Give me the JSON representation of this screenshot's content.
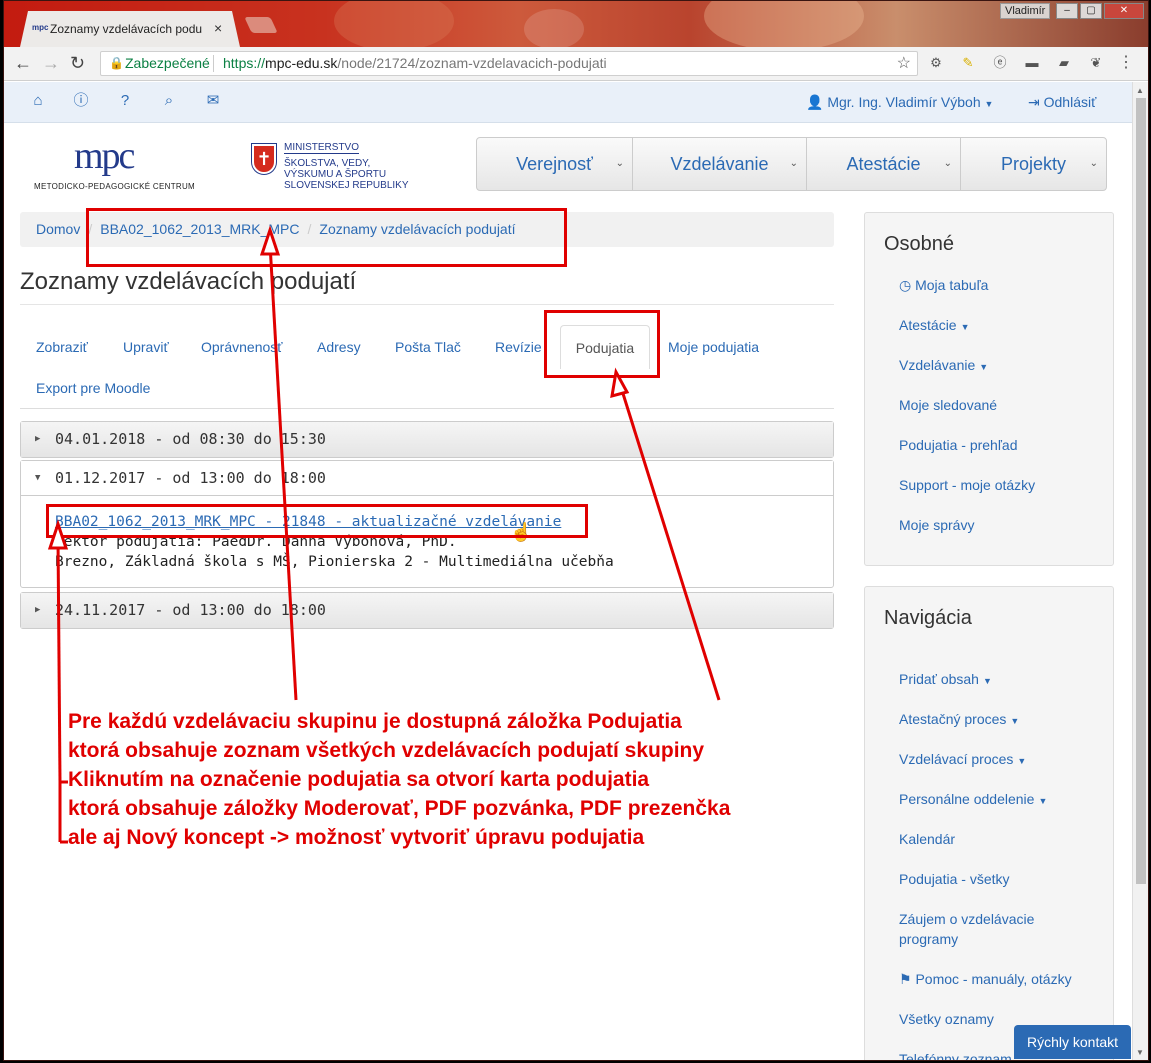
{
  "browser": {
    "tab_title": "Zoznamy vzdelávacích podu",
    "tab_close": "×",
    "favicon": "mpc",
    "user_label": "Vladimír",
    "window_buttons": [
      "–",
      "▢",
      "✕"
    ],
    "secure_label": "Zabezpečené",
    "url_scheme": "https://",
    "url_domain": "mpc-edu.sk",
    "url_path": "/node/21724/zoznam-vzdelavacich-podujati"
  },
  "topnav": {
    "user": "Mgr. Ing. Vladimír Výboh",
    "logout": "Odhlásiť"
  },
  "header": {
    "logo_text": "mpc",
    "logo_subtitle": "METODICKO-PEDAGOGICKÉ CENTRUM",
    "ministry_lines": [
      "MINISTERSTVO",
      "ŠKOLSTVA, VEDY,",
      "VÝSKUMU A ŠPORTU",
      "SLOVENSKEJ REPUBLIKY"
    ],
    "menu": [
      "Verejnosť",
      "Vzdelávanie",
      "Atestácie",
      "Projekty"
    ]
  },
  "breadcrumb": [
    "Domov",
    "BBA02_1062_2013_MRK_MPC",
    "Zoznamy vzdelávacích podujatí"
  ],
  "page_title": "Zoznamy vzdelávacích podujatí",
  "tabs": [
    "Zobraziť",
    "Upraviť",
    "Oprávnenosť",
    "Adresy",
    "Pošta Tlač",
    "Revízie",
    "Podujatia",
    "Moje podujatia",
    "Export pre Moodle"
  ],
  "events": [
    {
      "date": "04.01.2018 - od 08:30 do 15:30"
    },
    {
      "date": "01.12.2017 - od 13:00 do 18:00",
      "link": "BBA02_1062_2013_MRK_MPC - 21848 - aktualizačné vzdelávanie",
      "lector": "Lektor podujatia: PaedDr. Danna Výbohová, PhD.",
      "place": "Brezno, Základná škola s MŠ, Pionierska 2 - Multimediálna učebňa"
    },
    {
      "date": "24.11.2017 - od 13:00 do 18:00"
    }
  ],
  "sidebar_personal": {
    "title": "Osobné",
    "items": [
      "Moja tabuľa",
      "Atestácie",
      "Vzdelávanie",
      "Moje sledované",
      "Podujatia - prehľad",
      "Support - moje otázky",
      "Moje správy"
    ]
  },
  "sidebar_nav": {
    "title": "Navigácia",
    "items": [
      "Pridať obsah",
      "Atestačný proces",
      "Vzdelávací proces",
      "Personálne oddelenie",
      "Kalendár",
      "Podujatia - všetky",
      "Záujem o vzdelávacie",
      "programy",
      "Pomoc - manuály, otázky",
      "Všetky oznamy",
      "Telefónny zoznam"
    ]
  },
  "quick_contact": "Rýchly kontakt",
  "annotation": [
    "Pre každú vzdelávaciu skupinu je dostupná záložka Podujatia",
    "ktorá obsahuje zoznam všetkých vzdelávacích podujatí skupiny",
    "Kliknutím na označenie podujatia sa otvorí karta podujatia",
    "ktorá obsahuje záložky Moderovať, PDF pozvánka, PDF prezenčka",
    "ale aj Nový koncept -> možnosť vytvoriť úpravu podujatia"
  ],
  "colors": {
    "link": "#2b6ab4",
    "annotation": "#e00000",
    "secure": "#0b8043"
  }
}
